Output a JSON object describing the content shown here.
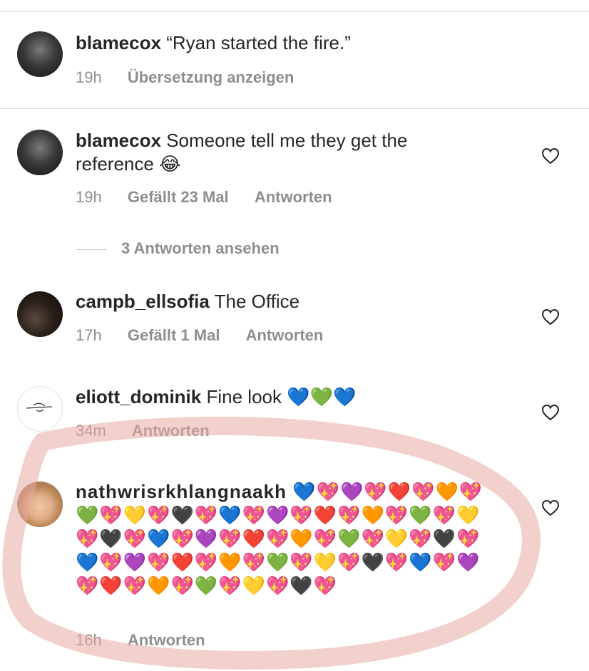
{
  "comments": [
    {
      "username": "blamecox",
      "text": "“Ryan started the fire.”",
      "time": "19h",
      "actions": [
        "Übersetzung anzeigen"
      ]
    },
    {
      "username": "blamecox",
      "text": "Someone tell me they get the reference 😂",
      "time": "19h",
      "likes": "Gefällt 23 Mal",
      "actions": [
        "Antworten"
      ],
      "view_replies": "3 Antworten ansehen"
    },
    {
      "username": "campb_ellsofia",
      "text": "The Office",
      "time": "17h",
      "likes": "Gefällt 1 Mal",
      "actions": [
        "Antworten"
      ]
    },
    {
      "username": "eliott_dominik",
      "text": "Fine look 💙💚💙",
      "time": "34m",
      "actions": [
        "Antworten"
      ]
    },
    {
      "username": "nathwrisrkhlangnaakh",
      "text": "💙💖💜💖❤️💖🧡💖💚💖💛💖🖤💖💙💖💜💖❤️💖🧡💖💚💖💛💖🖤💖💙💖💜💖❤️💖🧡💖💚💖💛💖🖤💖💙💖💜💖❤️💖🧡💖💚💖💛💖🖤💖💙💖💜💖❤️💖🧡💖💚💖💛💖🖤💖",
      "time": "16h",
      "actions": [
        "Antworten"
      ]
    }
  ],
  "icons": {
    "like": "heart-outline-icon"
  },
  "colors": {
    "text": "#262626",
    "meta": "#8e8e8e",
    "annotation": "#e8a9a3"
  }
}
